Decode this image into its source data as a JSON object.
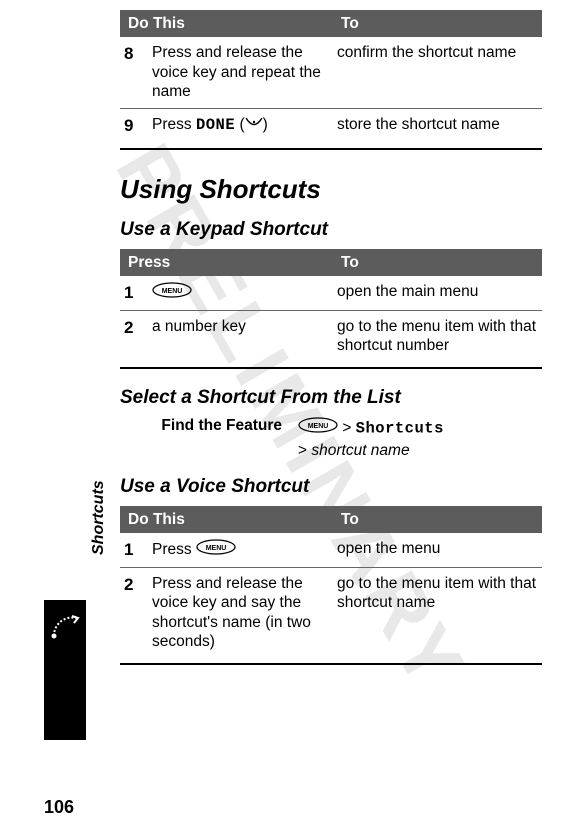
{
  "watermark": "PRELIMINARY",
  "sidebar_label": "Shortcuts",
  "page_number": "106",
  "table1": {
    "head_left": "Do This",
    "head_right": "To",
    "rows": [
      {
        "num": "8",
        "left": "Press and release the voice key and repeat the name",
        "right": "confirm the shortcut name"
      },
      {
        "num": "9",
        "left_prefix": "Press ",
        "left_mono": "DONE",
        "left_paren_open": " (",
        "left_paren_close": ")",
        "right": "store the shortcut name"
      }
    ]
  },
  "heading1": "Using Shortcuts",
  "sub1": "Use a Keypad Shortcut",
  "table2": {
    "head_left": "Press",
    "head_right": "To",
    "rows": [
      {
        "num": "1",
        "left_icon": true,
        "left": "",
        "right": "open the main menu"
      },
      {
        "num": "2",
        "left": "a number key",
        "right": "go to the menu item with that shortcut number"
      }
    ]
  },
  "sub2": "Select a Shortcut From the List",
  "find_feature": {
    "label": "Find the Feature",
    "path1_prefix": "> ",
    "path1_mono": "Shortcuts",
    "path2_prefix": "> ",
    "path2_italic": "shortcut name"
  },
  "sub3": "Use a Voice Shortcut",
  "table3": {
    "head_left": "Do This",
    "head_right": "To",
    "rows": [
      {
        "num": "1",
        "left_prefix": "Press ",
        "left_icon": true,
        "right": "open the menu"
      },
      {
        "num": "2",
        "left": "Press and release the voice key and say the shortcut's name (in two seconds)",
        "right": "go to the menu item with that shortcut name"
      }
    ]
  }
}
